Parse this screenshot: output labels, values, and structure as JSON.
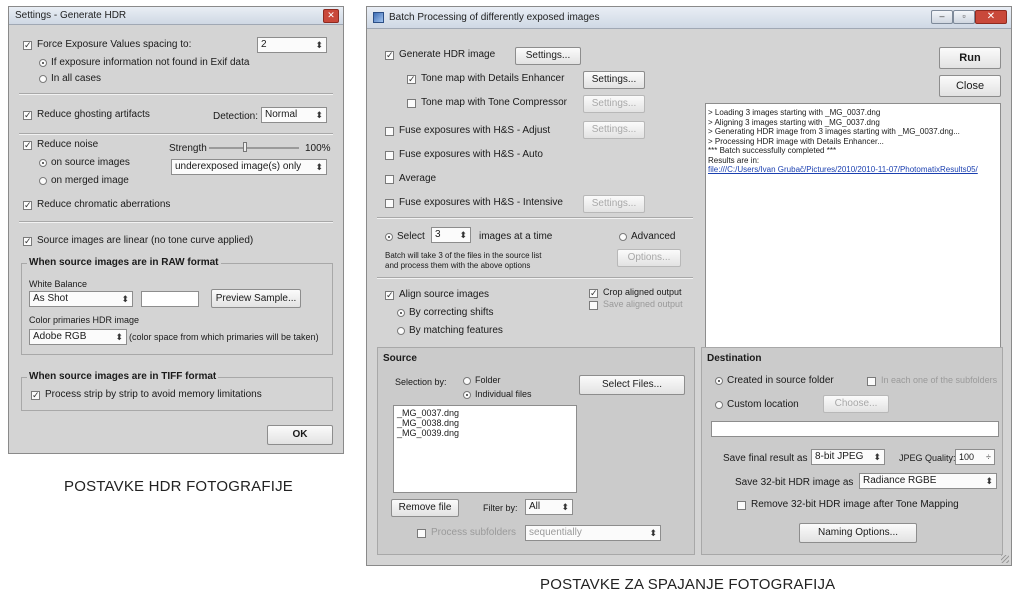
{
  "left_window": {
    "title": "Settings - Generate HDR",
    "force_ev_label": "Force Exposure Values spacing to:",
    "force_ev_value": "2",
    "if_exif_label": "If exposure information not found in Exif data",
    "in_all_cases_label": "In all cases",
    "ghosting_label": "Reduce ghosting artifacts",
    "detection_label": "Detection:",
    "detection_value": "Normal",
    "reduce_noise_label": "Reduce noise",
    "strength_label": "Strength",
    "strength_value": "100%",
    "strength_level": 0.4,
    "on_source_label": "on source images",
    "on_merged_label": "on merged image",
    "noise_target_value": "underexposed image(s) only",
    "chromatic_label": "Reduce chromatic aberrations",
    "linear_label": "Source images are linear (no tone curve applied)",
    "raw_group_title": "When source images are in RAW format",
    "white_balance_label": "White Balance",
    "white_balance_value": "As Shot",
    "preview_sample_label": "Preview Sample...",
    "color_primaries_label": "Color primaries HDR image",
    "color_primaries_value": "Adobe RGB",
    "color_space_note": "(color space from which primaries will be taken)",
    "tiff_group_title": "When source images are in TIFF format",
    "strip_label": "Process strip by strip to avoid memory limitations",
    "ok_label": "OK"
  },
  "left_caption": "POSTAVKE HDR FOTOGRAFIJE",
  "right_window": {
    "title": "Batch Processing of differently exposed images",
    "generate_hdr_label": "Generate HDR image",
    "settings_label": "Settings...",
    "tone_details_label": "Tone map with Details Enhancer",
    "tone_compressor_label": "Tone map with Tone Compressor",
    "fuse_adjust_label": "Fuse exposures with H&S - Adjust",
    "fuse_auto_label": "Fuse exposures with H&S - Auto",
    "average_label": "Average",
    "fuse_intensive_label": "Fuse exposures with H&S - Intensive",
    "run_label": "Run",
    "close_label": "Close",
    "log_lines": [
      "> Loading 3 images starting with _MG_0037.dng",
      "> Aligning 3 images starting with _MG_0037.dng",
      "> Generating HDR image from 3 images starting with _MG_0037.dng...",
      "> Processing HDR image with Details Enhancer...",
      "*** Batch successfully completed ***",
      "Results are in:"
    ],
    "log_link": "file:///C:/Users/Ivan Grubač/Pictures/2010/2010-11-07/PhotomatixResults05/",
    "select_label": "Select",
    "select_value": "3",
    "images_at_time_label": "images at a time",
    "advanced_label": "Advanced",
    "options_label": "Options...",
    "batch_note_line1": "Batch will take 3 of the files in the source list",
    "batch_note_line2": "and process them with the above options",
    "align_label": "Align source images",
    "crop_label": "Crop aligned output",
    "save_aligned_label": "Save aligned output",
    "by_shifts_label": "By correcting shifts",
    "by_features_label": "By matching features",
    "source_title": "Source",
    "selection_by_label": "Selection by:",
    "folder_label": "Folder",
    "individual_files_label": "Individual files",
    "select_files_label": "Select Files...",
    "files": [
      "_MG_0037.dng",
      "_MG_0038.dng",
      "_MG_0039.dng"
    ],
    "remove_file_label": "Remove file",
    "filter_by_label": "Filter by:",
    "filter_value": "All",
    "process_subfolders_label": "Process subfolders",
    "sequentially_value": "sequentially",
    "destination_title": "Destination",
    "created_in_source_label": "Created in source folder",
    "in_each_one_label": "In each one of the subfolders",
    "custom_location_label": "Custom location",
    "choose_label": "Choose...",
    "save_final_label": "Save final result as",
    "save_final_value": "8-bit JPEG",
    "jpeg_quality_label": "JPEG Quality:",
    "jpeg_quality_value": "100",
    "save_32_label": "Save 32-bit HDR image as",
    "save_32_value": "Radiance RGBE",
    "remove_32_label": "Remove 32-bit HDR image after Tone Mapping",
    "naming_options_label": "Naming Options..."
  },
  "right_caption": "POSTAVKE ZA SPAJANJE FOTOGRAFIJA",
  "icons": {
    "close": "close-icon",
    "minimize": "minimize-icon",
    "maximize": "maximize-icon",
    "app": "app-icon",
    "dropdown": "chevron-down-icon"
  },
  "colors": {
    "close_button": "#c9483a",
    "link": "#1a3fb0",
    "window_bg": "#d4d4d4"
  }
}
